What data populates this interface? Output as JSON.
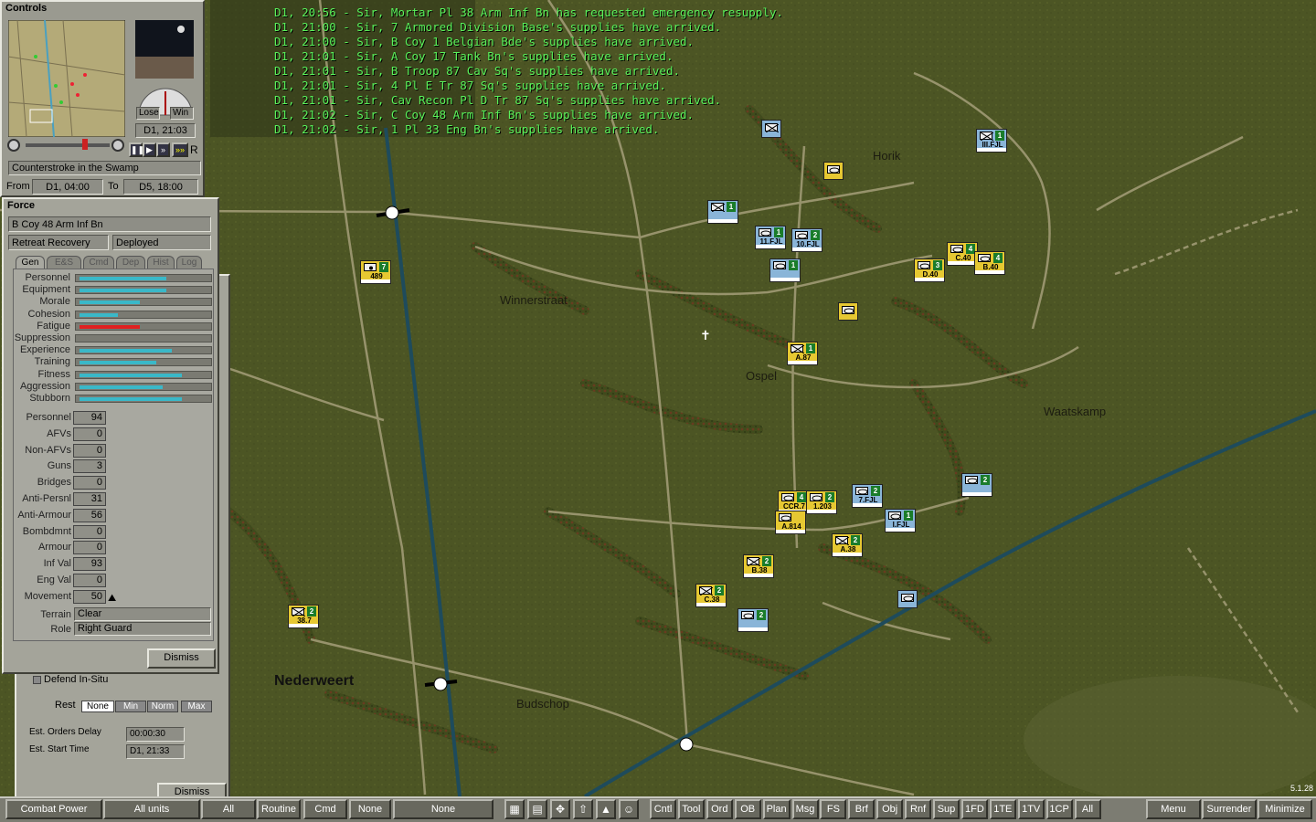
{
  "messages": [
    "D1, 20:56 - Sir, Mortar Pl 38 Arm Inf Bn has requested emergency resupply.",
    "D1, 21:00 - Sir, 7 Armored Division Base's supplies have arrived.",
    "D1, 21:00 - Sir, B Coy 1 Belgian Bde's supplies have arrived.",
    "D1, 21:01 - Sir, A Coy 17 Tank Bn's supplies have arrived.",
    "D1, 21:01 - Sir, B Troop 87 Cav Sq's supplies have arrived.",
    "D1, 21:01 - Sir, 4 Pl E Tr 87 Sq's supplies have arrived.",
    "D1, 21:01 - Sir, Cav Recon Pl D Tr 87 Sq's supplies have arrived.",
    "D1, 21:02 - Sir, C Coy 48 Arm Inf Bn's supplies have arrived.",
    "D1, 21:02 - Sir, 1 Pl 33 Eng Bn's supplies have arrived."
  ],
  "map_labels": {
    "horik": "Horik",
    "winnerstraat": "Winnerstraat",
    "ospel": "Ospel",
    "waatskamp": "Waatskamp",
    "nederweert": "Nederweert",
    "budschop": "Budschop"
  },
  "version": "5.1.28",
  "controls": {
    "title": "Controls",
    "lose_label": "Lose",
    "win_label": "Win",
    "clock": "D1, 21:03",
    "scenario": "Counterstroke in the Swamp",
    "from_label": "From",
    "from_value": "D1, 04:00",
    "to_label": "To",
    "to_value": "D5, 18:00",
    "r_label": "R"
  },
  "force": {
    "title": "Force",
    "unit_name": "B Coy 48 Arm Inf Bn",
    "status1": "Retreat Recovery",
    "status2": "Deployed",
    "tabs": [
      "Gen",
      "E&S",
      "Cmd",
      "Dep",
      "Hist",
      "Log"
    ],
    "bars": [
      {
        "label": "Personnel",
        "value": 0.68,
        "color": "#3ab8c8"
      },
      {
        "label": "Equipment",
        "value": 0.68,
        "color": "#3ab8c8"
      },
      {
        "label": "Morale",
        "value": 0.47,
        "color": "#3ab8c8"
      },
      {
        "label": "Cohesion",
        "value": 0.3,
        "color": "#3ab8c8"
      },
      {
        "label": "Fatigue",
        "value": 0.47,
        "color": "#e02020"
      },
      {
        "label": "Suppression",
        "value": 0.0,
        "color": "#3ab8c8"
      },
      {
        "label": "Experience",
        "value": 0.72,
        "color": "#3ab8c8"
      },
      {
        "label": "Training",
        "value": 0.6,
        "color": "#3ab8c8"
      },
      {
        "label": "Fitness",
        "value": 0.8,
        "color": "#3ab8c8"
      },
      {
        "label": "Aggression",
        "value": 0.65,
        "color": "#3ab8c8"
      },
      {
        "label": "Stubborn",
        "value": 0.8,
        "color": "#3ab8c8"
      }
    ],
    "stats": [
      {
        "label": "Personnel",
        "value": "94"
      },
      {
        "label": "AFVs",
        "value": "0"
      },
      {
        "label": "Non-AFVs",
        "value": "0"
      },
      {
        "label": "Guns",
        "value": "3"
      },
      {
        "label": "Bridges",
        "value": "0"
      },
      {
        "label": "Anti-Persnl",
        "value": "31"
      },
      {
        "label": "Anti-Armour",
        "value": "56"
      },
      {
        "label": "Bombdmnt",
        "value": "0"
      },
      {
        "label": "Armour",
        "value": "0"
      },
      {
        "label": "Inf Val",
        "value": "93"
      },
      {
        "label": "Eng Val",
        "value": "0"
      },
      {
        "label": "Movement",
        "value": "50"
      }
    ],
    "terrain_label": "Terrain",
    "terrain_value": "Clear",
    "role_label": "Role",
    "role_value": "Right Guard",
    "dismiss": "Dismiss"
  },
  "orders": {
    "defend_label": "Defend In-Situ",
    "rest_label": "Rest",
    "rest_options": [
      "None",
      "Min",
      "Norm",
      "Max"
    ],
    "rest_selected": "None",
    "delay_label": "Est. Orders Delay",
    "delay_value": "00:00:30",
    "start_label": "Est. Start Time",
    "start_value": "D1, 21:33",
    "dismiss": "Dismiss"
  },
  "units": [
    {
      "name": "",
      "num": "",
      "side": "ger",
      "icon": "inf"
    },
    {
      "name": "",
      "num": "1",
      "side": "ger",
      "icon": "inf"
    },
    {
      "name": "",
      "num": "",
      "side": "us",
      "icon": "arm"
    },
    {
      "name": "",
      "num": "1",
      "side": "ger",
      "icon": "arm"
    },
    {
      "name": "11.FJL",
      "num": "1",
      "side": "ger",
      "icon": "arm"
    },
    {
      "name": "10.FJL",
      "num": "2",
      "side": "ger",
      "icon": "arm"
    },
    {
      "name": "",
      "num": "1",
      "side": "ger",
      "icon": "arm"
    },
    {
      "name": "489",
      "num": "7",
      "side": "us",
      "icon": "art"
    },
    {
      "name": "C.40",
      "num": "4",
      "side": "us",
      "icon": "arm"
    },
    {
      "name": "B.40",
      "num": "4",
      "side": "us",
      "icon": "arm"
    },
    {
      "name": "D.40",
      "num": "3",
      "side": "us",
      "icon": "arm"
    },
    {
      "name": "",
      "num": "",
      "side": "us",
      "icon": "arm"
    },
    {
      "name": "A.87",
      "num": "1",
      "side": "us",
      "icon": "inf"
    },
    {
      "name": "",
      "num": "2",
      "side": "ger",
      "icon": "arm"
    },
    {
      "name": "CCR.7",
      "num": "4",
      "side": "us",
      "icon": "arm"
    },
    {
      "name": "1.203",
      "num": "2",
      "side": "us",
      "icon": "arm"
    },
    {
      "name": "A.814",
      "num": "",
      "side": "us",
      "icon": "arm"
    },
    {
      "name": "7.FJL",
      "num": "2",
      "side": "ger",
      "icon": "arm"
    },
    {
      "name": "I.FJL",
      "num": "1",
      "side": "ger",
      "icon": "arm"
    },
    {
      "name": "A.38",
      "num": "2",
      "side": "us",
      "icon": "inf"
    },
    {
      "name": "B.38",
      "num": "2",
      "side": "us",
      "icon": "inf"
    },
    {
      "name": "C.38",
      "num": "2",
      "side": "us",
      "icon": "inf"
    },
    {
      "name": "",
      "num": "2",
      "side": "ger",
      "icon": "arm"
    },
    {
      "name": "",
      "num": "",
      "side": "ger",
      "icon": "arm"
    },
    {
      "name": "38.7",
      "num": "2",
      "side": "us",
      "icon": "inf"
    },
    {
      "name": "III.FJL",
      "num": "1",
      "side": "ger",
      "icon": "inf"
    }
  ],
  "bottombar": {
    "left_buttons": [
      "Combat Power",
      "All units",
      "All",
      "Routine",
      "Cmd",
      "None",
      "None"
    ],
    "right_buttons": [
      "Cntl",
      "Tool",
      "Ord",
      "OB",
      "Plan",
      "Msg",
      "FS",
      "Brf",
      "Obj",
      "Rnf",
      "Sup",
      "1FD",
      "1TE",
      "1TV",
      "1CP",
      "All"
    ],
    "menu": "Menu",
    "surrender": "Surrender",
    "minimize": "Minimize"
  }
}
